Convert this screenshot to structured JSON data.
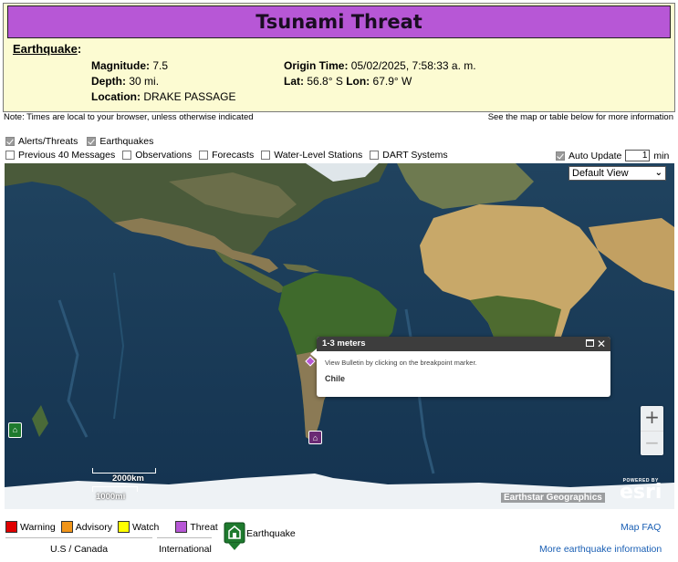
{
  "header": {
    "title": "Tsunami Threat",
    "section": "Earthquake",
    "magnitude_label": "Magnitude:",
    "magnitude": "7.5",
    "depth_label": "Depth:",
    "depth": "30 mi.",
    "location_label": "Location:",
    "location": "DRAKE PASSAGE",
    "origin_label": "Origin Time:",
    "origin_time": "05/02/2025, 7:58:33 a. m.",
    "lat_label": "Lat:",
    "lat": "56.8° S",
    "lon_label": "Lon:",
    "lon": "67.9° W"
  },
  "notes": {
    "left": "Note: Times are local to your browser, unless otherwise indicated",
    "right": "See the map or table below for more information"
  },
  "layers": {
    "alerts": {
      "label": "Alerts/Threats",
      "checked": true
    },
    "earthquakes": {
      "label": "Earthquakes",
      "checked": true
    },
    "previous": {
      "label": "Previous 40 Messages",
      "checked": false
    },
    "observations": {
      "label": "Observations",
      "checked": false
    },
    "forecasts": {
      "label": "Forecasts",
      "checked": false
    },
    "water_level": {
      "label": "Water-Level Stations",
      "checked": false
    },
    "dart": {
      "label": "DART Systems",
      "checked": false
    }
  },
  "auto_update": {
    "label": "Auto Update",
    "checked": true,
    "value": "1",
    "unit": "min"
  },
  "map": {
    "view_select": "Default View",
    "popup": {
      "title": "1-3 meters",
      "body": "View Bulletin by clicking on the breakpoint marker.",
      "place": "Chile"
    },
    "zoom_in": "+",
    "zoom_out": "−",
    "scale_km": "2000km",
    "scale_mi": "1000mi",
    "attribution": "Earthstar Geographics",
    "powered_by": "POWERED BY",
    "esri": "esri"
  },
  "legend": {
    "warning": {
      "label": "Warning",
      "color": "#e00000"
    },
    "advisory": {
      "label": "Advisory",
      "color": "#f0951a"
    },
    "watch": {
      "label": "Watch",
      "color": "#ffff00"
    },
    "threat": {
      "label": "Threat",
      "color": "#b757d6"
    },
    "us_canada": "U.S / Canada",
    "international": "International",
    "earthquake": "Earthquake"
  },
  "links": {
    "faq": "Map FAQ",
    "more_eq": "More earthquake information"
  },
  "colors": {
    "threat_bar": "#b757d6",
    "panel_bg": "#fcfbd2",
    "link": "#1a5fb4",
    "earthquake_marker": "#1e7a2e"
  }
}
